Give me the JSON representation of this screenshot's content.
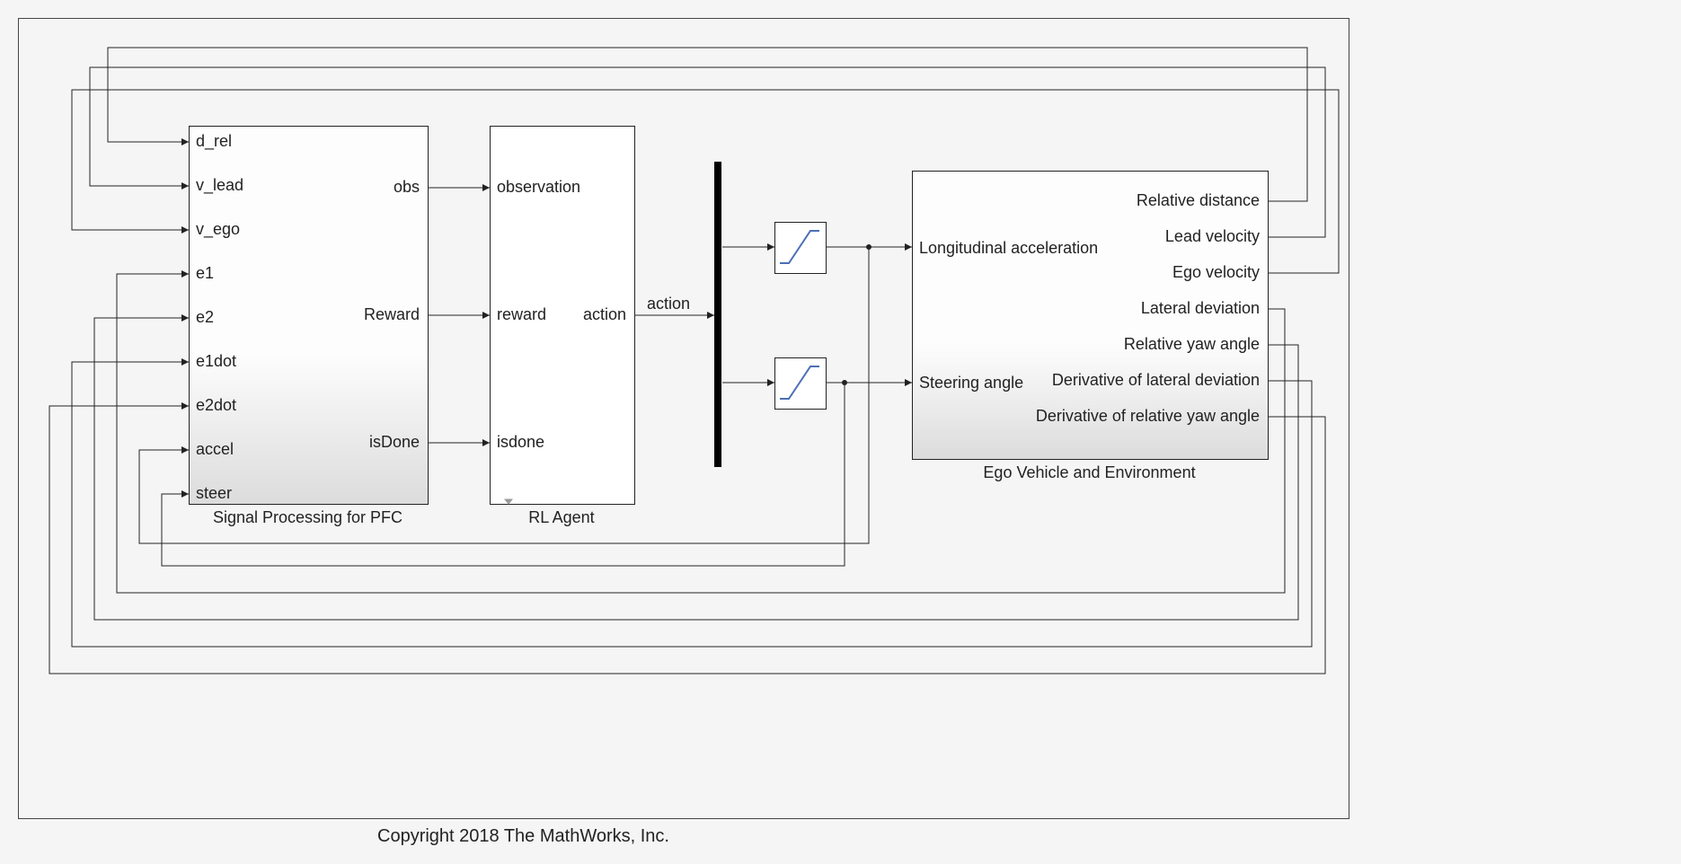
{
  "blocks": {
    "sigproc": {
      "title": "Signal Processing for PFC",
      "inputs": [
        "d_rel",
        "v_lead",
        "v_ego",
        "e1",
        "e2",
        "e1dot",
        "e2dot",
        "accel",
        "steer"
      ],
      "outputs": [
        "obs",
        "Reward",
        "isDone"
      ]
    },
    "rlagent": {
      "title": "RL Agent",
      "inputs": [
        "observation",
        "reward",
        "isdone"
      ],
      "outputs": [
        "action"
      ]
    },
    "envblock": {
      "title": "Ego Vehicle and Environment",
      "inputs": [
        "Longitudinal acceleration",
        "Steering angle"
      ],
      "outputs": [
        "Relative distance",
        "Lead velocity",
        "Ego velocity",
        "Lateral deviation",
        "Relative yaw angle",
        "Derivative of lateral deviation",
        "Derivative of relative yaw angle"
      ]
    }
  },
  "signals": {
    "action": "action"
  },
  "copyright": "Copyright 2018 The MathWorks, Inc."
}
